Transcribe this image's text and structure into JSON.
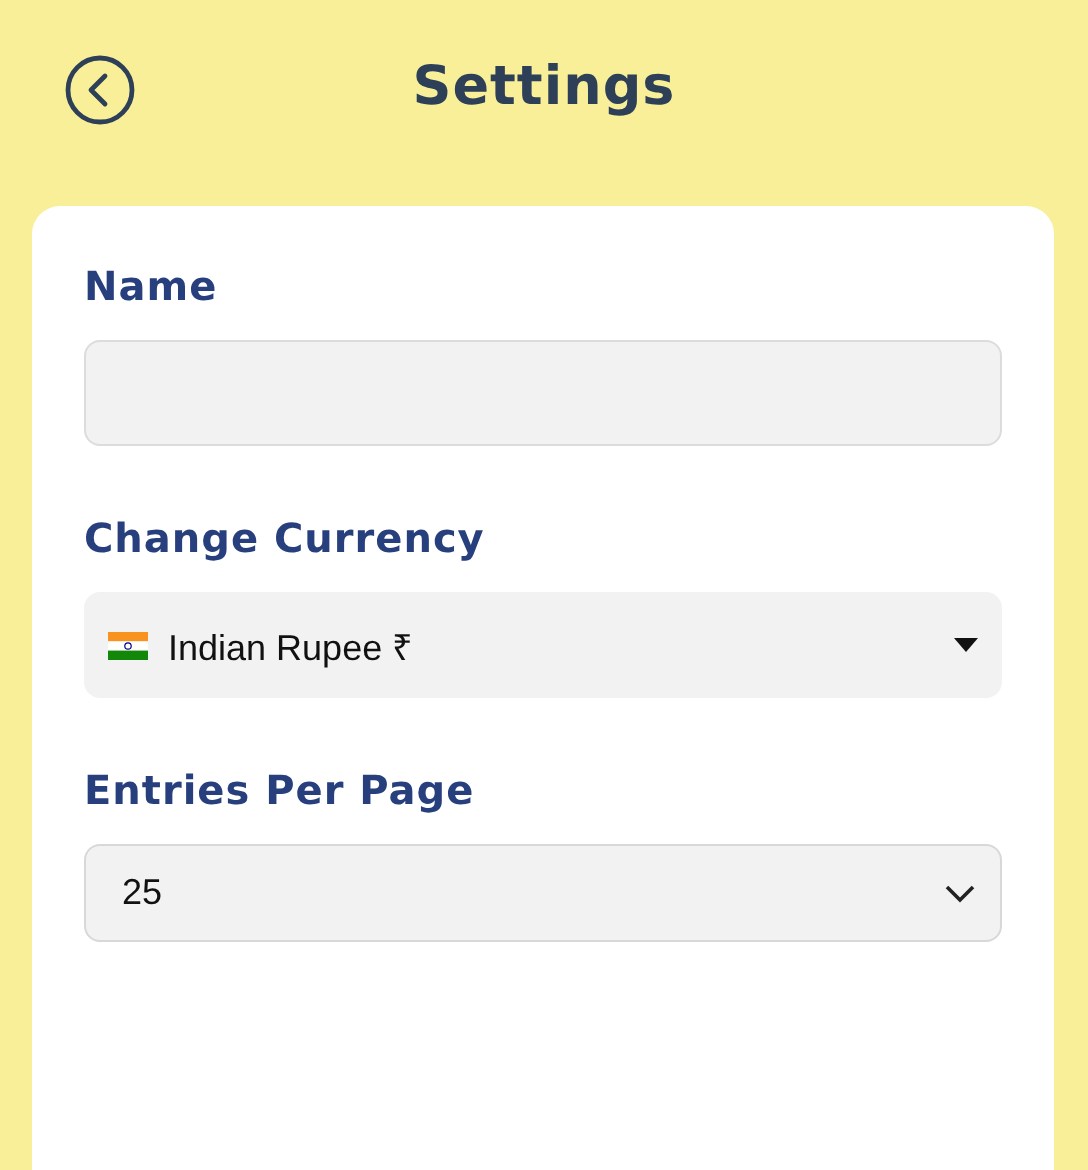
{
  "header": {
    "title": "Settings"
  },
  "fields": [
    {
      "kind": "text",
      "label": "Name"
    },
    {
      "kind": "flag-select",
      "label": "Change Currency",
      "value": "Indian Rupee ₹"
    },
    {
      "kind": "select",
      "label": "Entries Per Page",
      "value": "25"
    }
  ]
}
